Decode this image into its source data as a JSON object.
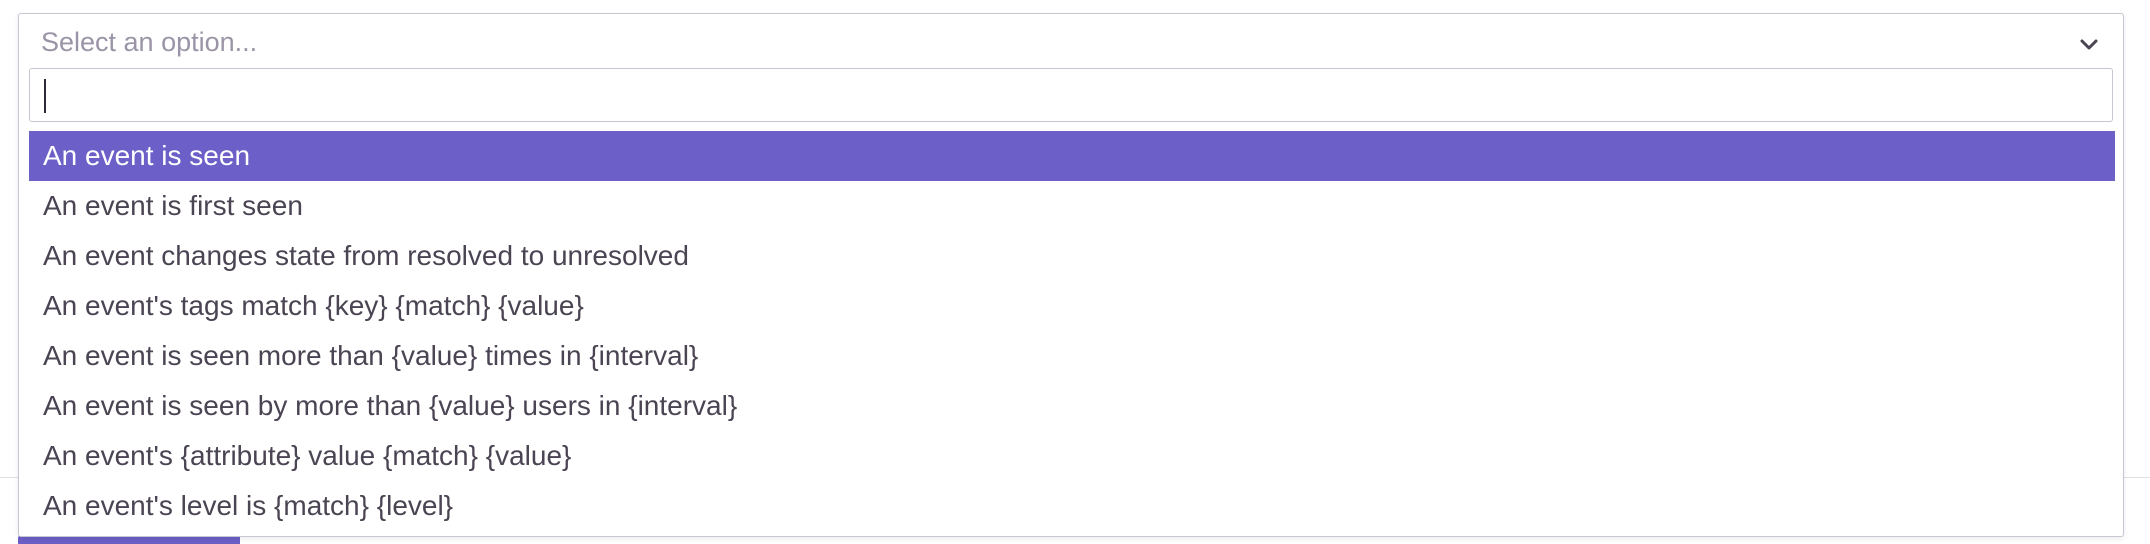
{
  "select": {
    "placeholder": "Select an option...",
    "search_value": "",
    "chevron_icon": "chevron-down-icon",
    "accent_color": "#6c5fc7",
    "options": [
      {
        "label": "An event is seen",
        "selected": true
      },
      {
        "label": "An event is first seen",
        "selected": false
      },
      {
        "label": "An event changes state from resolved to unresolved",
        "selected": false
      },
      {
        "label": "An event's tags match {key} {match} {value}",
        "selected": false
      },
      {
        "label": "An event is seen more than {value} times in {interval}",
        "selected": false
      },
      {
        "label": "An event is seen by more than {value} users in {interval}",
        "selected": false
      },
      {
        "label": "An event's {attribute} value {match} {value}",
        "selected": false
      },
      {
        "label": "An event's level is {match} {level}",
        "selected": false
      }
    ]
  }
}
